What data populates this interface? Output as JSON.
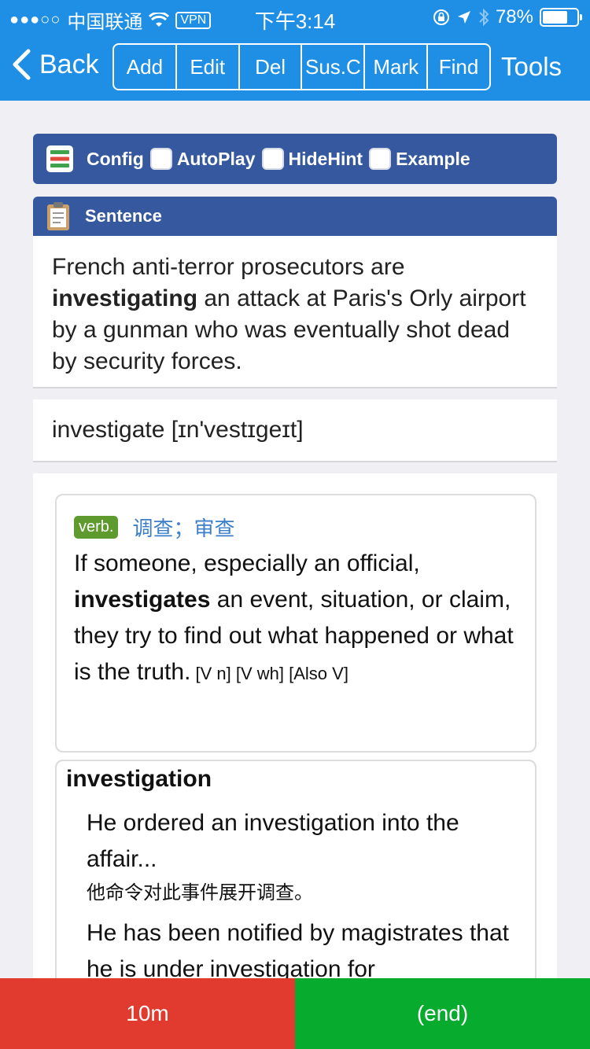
{
  "status_bar": {
    "signal": "●●●○○",
    "carrier": "中国联通",
    "vpn": "VPN",
    "time": "下午3:14",
    "battery": "78%"
  },
  "nav": {
    "back_label": "Back",
    "segments": [
      "Add",
      "Edit",
      "Del",
      "Sus.C",
      "Mark",
      "Find"
    ],
    "tools_label": "Tools"
  },
  "config": {
    "label": "Config",
    "options": [
      "AutoPlay",
      "HideHint",
      "Example"
    ]
  },
  "sentence": {
    "title": "Sentence",
    "before": "French anti-terror prosecutors are ",
    "keyword": "investigating",
    "after": " an attack at Paris's Orly airport by a gunman who was eventually shot dead by security forces."
  },
  "word": {
    "headword": "investigate [ɪn'vestɪgeɪt]"
  },
  "definition": {
    "pos": "verb.",
    "zh": "调查；审查",
    "before": "If someone, especially an official, ",
    "keyword": "investigates",
    "after": " an event, situation, or claim, they try to find out what happened or what is the truth.",
    "grammar": "  [V n]  [V wh]  [Also V]"
  },
  "examples": {
    "headword": "investigation",
    "items": [
      {
        "en": "He ordered an investigation into the affair...",
        "zh": "他命令对此事件展开调查。"
      },
      {
        "en": "He has been notified by magistrates that he is under investigation for",
        "zh": ""
      }
    ]
  },
  "bottom": {
    "left_label": "10m",
    "right_label": "(end)"
  },
  "colors": {
    "nav_bg": "#1f8fe6",
    "header_bg": "#35589f",
    "verb_badge": "#5e9a2d",
    "red_button": "#e13a2e",
    "green_button": "#07ab2d"
  }
}
